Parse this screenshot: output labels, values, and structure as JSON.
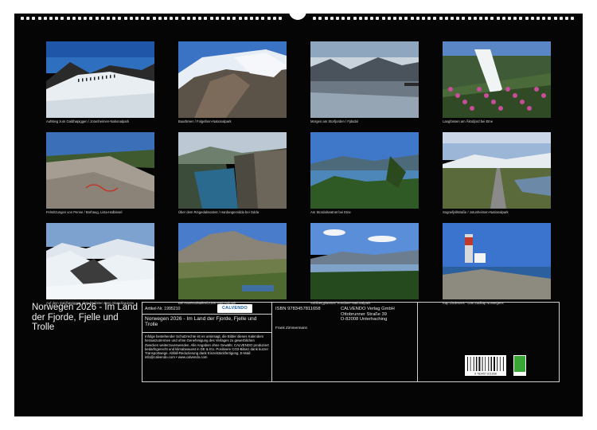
{
  "photos": [
    {
      "caption": "Aufstieg zum Galdhøpiggen / Jotunheimen-Nationalpark",
      "kind": "glacier-hikers"
    },
    {
      "caption": "Buarbreen / Folgefonn-Nationalpark",
      "kind": "glacier-tongue"
    },
    {
      "caption": "Morgen am Storfjorden / Fjdsdal",
      "kind": "fjord-reflection"
    },
    {
      "caption": "Langfossen am Åkrafjord bei Etne",
      "kind": "waterfall-flowers"
    },
    {
      "caption": "Felsritzungen von Penne / Borhaug, Lista-Halbinsel",
      "kind": "rock-carvings"
    },
    {
      "caption": "Über dem Ringedalsvatnet / Hardangervidda bei Odda",
      "kind": "fjord-cliff"
    },
    {
      "caption": "Am Stordalsvatnet bei Etne",
      "kind": "lake-trees"
    },
    {
      "caption": "Sognefjellstraße / Jotunheimen-Nationalpark",
      "kind": "mountain-road"
    },
    {
      "caption": "Auf dem Galdhøpiggen, dem höchsten Berg Skandinaviens",
      "kind": "snow-summit"
    },
    {
      "caption": "Bei Haventalstølen/Dovre-Nationalpark",
      "kind": "tundra"
    },
    {
      "caption": "Sohlbergplassen/ Rondane-Nationalpark",
      "kind": "forest-lake"
    },
    {
      "caption": "Kap Lindesnes - Das Südkap Norwegens",
      "kind": "lighthouse"
    }
  ],
  "title": "Norwegen 2026 - Im Land der Fjorde, Fjelle und Trolle",
  "article_label": "Artikel-Nr. 1995210",
  "logo_text": "CALVENDO",
  "box_title": "Norwegen 2026 - Im Land der Fjorde, Fjelle und Trolle",
  "legal_text": "Infolge bestehender Schutzrechte ist es untersagt, die Bilder dieses Kalenders herauszutrennen und ohne Genehmigung des Verlages zu gewerblichen Zwecken weiterzuverwenden. Alle Angaben ohne Gewähr. CALVENDO produziert bedarfsgerecht und klimabewusst in DE & EU. Positivere CO2-Bilanz dank kurzer Transportwege. Abfall-Reduzierung dank Einzelstückfertigung. E-Mail: info@calvendo.com • www.calvendo.com",
  "isbn": "ISBN 9783457811658",
  "author": "Frank Zimmermann",
  "publisher": [
    "CALVENDO Verlag GmbH",
    "Ottobrunner Straße 39",
    "D-82008 Unterhaching"
  ],
  "barcode_number": "9 783457 811658"
}
